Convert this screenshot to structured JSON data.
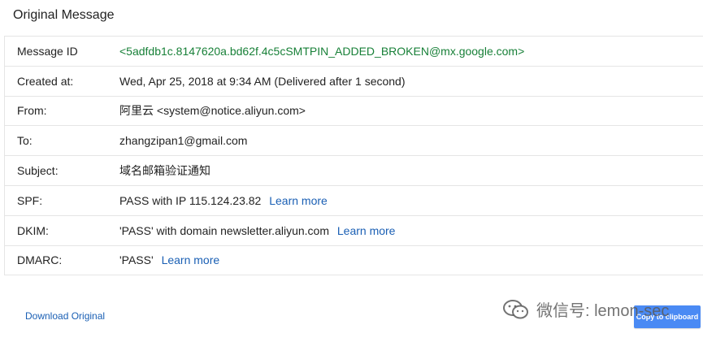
{
  "header": {
    "title": "Original Message"
  },
  "rows": [
    {
      "label": "Message ID",
      "value": "<5adfdb1c.8147620a.bd62f.4c5cSMTPIN_ADDED_BROKEN@mx.google.com>"
    },
    {
      "label": "Created at:",
      "value": "Wed, Apr 25, 2018 at 9:34 AM (Delivered after 1 second)"
    },
    {
      "label": "From:",
      "value": "阿里云 <system@notice.aliyun.com>"
    },
    {
      "label": "To:",
      "value": "zhangzipan1@gmail.com"
    },
    {
      "label": "Subject:",
      "value": "域名邮箱验证通知"
    },
    {
      "label": "SPF:",
      "value": "PASS with IP 115.124.23.82",
      "link": "Learn more"
    },
    {
      "label": "DKIM:",
      "value": "'PASS' with domain newsletter.aliyun.com",
      "link": "Learn more"
    },
    {
      "label": "DMARC:",
      "value": "'PASS'",
      "link": "Learn more"
    }
  ],
  "footer": {
    "download_label": "Download Original",
    "copy_label": "Copy to clipboard"
  },
  "watermark": {
    "text": "微信号: lemon-sec",
    "icon": "wechat-icon"
  },
  "colors": {
    "message_id": "#188038",
    "link": "#1a5fb4",
    "button": "#4a8af4"
  }
}
